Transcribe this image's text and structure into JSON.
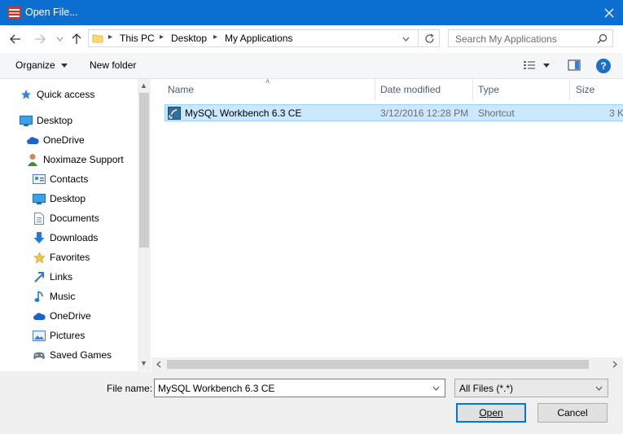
{
  "window": {
    "title": "Open File..."
  },
  "address": {
    "crumbs": [
      "This PC",
      "Desktop",
      "My Applications"
    ]
  },
  "search": {
    "placeholder": "Search My Applications"
  },
  "toolbar": {
    "organize": "Organize",
    "new_folder": "New folder"
  },
  "sidebar": {
    "items": [
      {
        "label": "Quick access",
        "icon": "star-icon"
      },
      {
        "label": "Desktop",
        "icon": "desktop-icon"
      },
      {
        "label": "OneDrive",
        "icon": "cloud-icon"
      },
      {
        "label": "Noximaze Support",
        "icon": "user-icon"
      },
      {
        "label": "Contacts",
        "icon": "contacts-icon"
      },
      {
        "label": "Desktop",
        "icon": "desktop-icon"
      },
      {
        "label": "Documents",
        "icon": "document-icon"
      },
      {
        "label": "Downloads",
        "icon": "download-icon"
      },
      {
        "label": "Favorites",
        "icon": "star-icon"
      },
      {
        "label": "Links",
        "icon": "link-icon"
      },
      {
        "label": "Music",
        "icon": "music-icon"
      },
      {
        "label": "OneDrive",
        "icon": "cloud-icon"
      },
      {
        "label": "Pictures",
        "icon": "pictures-icon"
      },
      {
        "label": "Saved Games",
        "icon": "games-icon"
      }
    ]
  },
  "files": {
    "columns": [
      "Name",
      "Date modified",
      "Type",
      "Size"
    ],
    "rows": [
      {
        "name": "MySQL Workbench 6.3 CE",
        "date": "3/12/2016 12:28 PM",
        "type": "Shortcut",
        "size": "3 K"
      }
    ]
  },
  "footer": {
    "file_name_label": "File name:",
    "file_name_value": "MySQL Workbench 6.3 CE",
    "filter": "All Files (*.*)",
    "open": "Open",
    "cancel": "Cancel"
  },
  "colors": {
    "titlebar": "#0a6fd1",
    "selection": "#cce8ff",
    "accent": "#0078d7"
  }
}
